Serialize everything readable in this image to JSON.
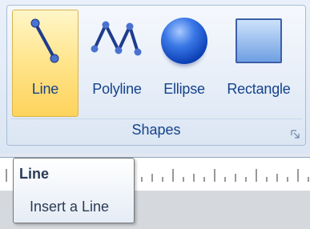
{
  "ribbon": {
    "group": {
      "label": "Shapes",
      "buttons": [
        {
          "label": "Line",
          "icon": "line-icon",
          "active": true
        },
        {
          "label": "Polyline",
          "icon": "polyline-icon",
          "active": false
        },
        {
          "label": "Ellipse",
          "icon": "ellipse-icon",
          "active": false
        },
        {
          "label": "Rectangle",
          "icon": "rectangle-icon",
          "active": false
        }
      ],
      "launcher_icon": "dialog-launcher-icon"
    }
  },
  "tooltip": {
    "title": "Line",
    "description": "Insert a Line"
  },
  "colors": {
    "ribbon_text": "#15428b",
    "active_button": "#ffe48a",
    "icon_blue": "#2b56b8"
  }
}
